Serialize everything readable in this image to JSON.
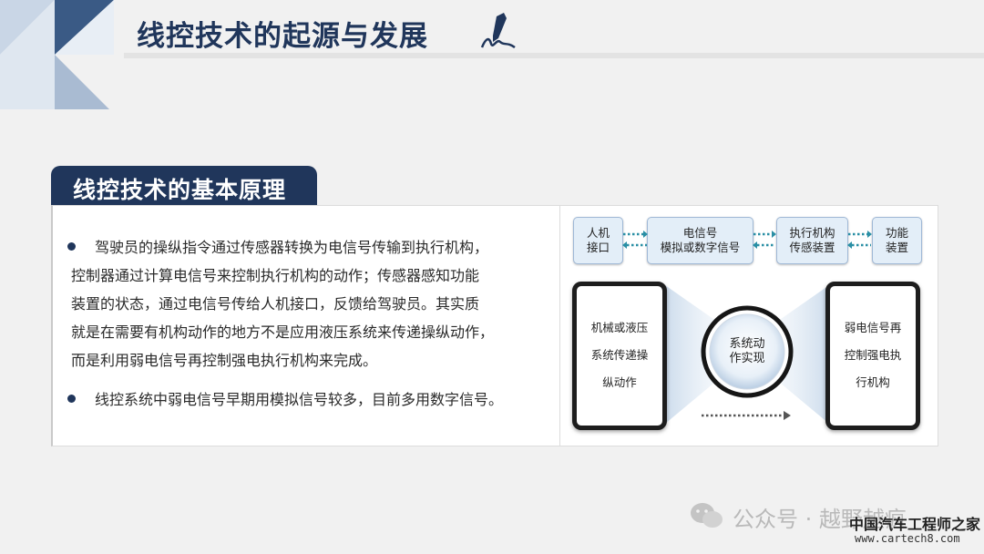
{
  "header": {
    "title": "线控技术的起源与发展",
    "pen_icon": "pen-writing-icon"
  },
  "section": {
    "title": "线控技术的基本原理"
  },
  "content": {
    "paragraph_1": [
      "驾驶员的操纵指令通过传感器转换为电信号传输到执行机构，",
      "控制器通过计算电信号来控制执行机构的动作；传感器感知功能",
      "装置的状态，通过电信号传给人机接口，反馈给驾驶员。其实质",
      "就是在需要有机构动作的地方不是应用液压系统来传递操纵动作，",
      "而是利用弱电信号再控制强电执行机构来完成。"
    ],
    "paragraph_2": "线控系统中弱电信号早期用模拟信号较多，目前多用数字信号。"
  },
  "diagram": {
    "box_hmi": [
      "人机",
      "接口"
    ],
    "box_signal": [
      "电信号",
      "模拟或数字信号"
    ],
    "box_actuator": [
      "执行机构",
      "传感装置"
    ],
    "box_function": [
      "功能",
      "装置"
    ],
    "left_device": [
      "机械或液压",
      "系统传递操",
      "纵动作"
    ],
    "center_circle": [
      "系统动",
      "作实现"
    ],
    "right_device": [
      "弱电信号再",
      "控制强电执",
      "行机构"
    ]
  },
  "watermark": {
    "wechat": "公众号 · 越野越疯",
    "site_cn": "中国汽车工程师之家",
    "site_url": "www.cartech8.com"
  },
  "colors": {
    "primary": "#20365b",
    "box_fill": "#e3eef8",
    "arrow": "#2a8fa5"
  }
}
